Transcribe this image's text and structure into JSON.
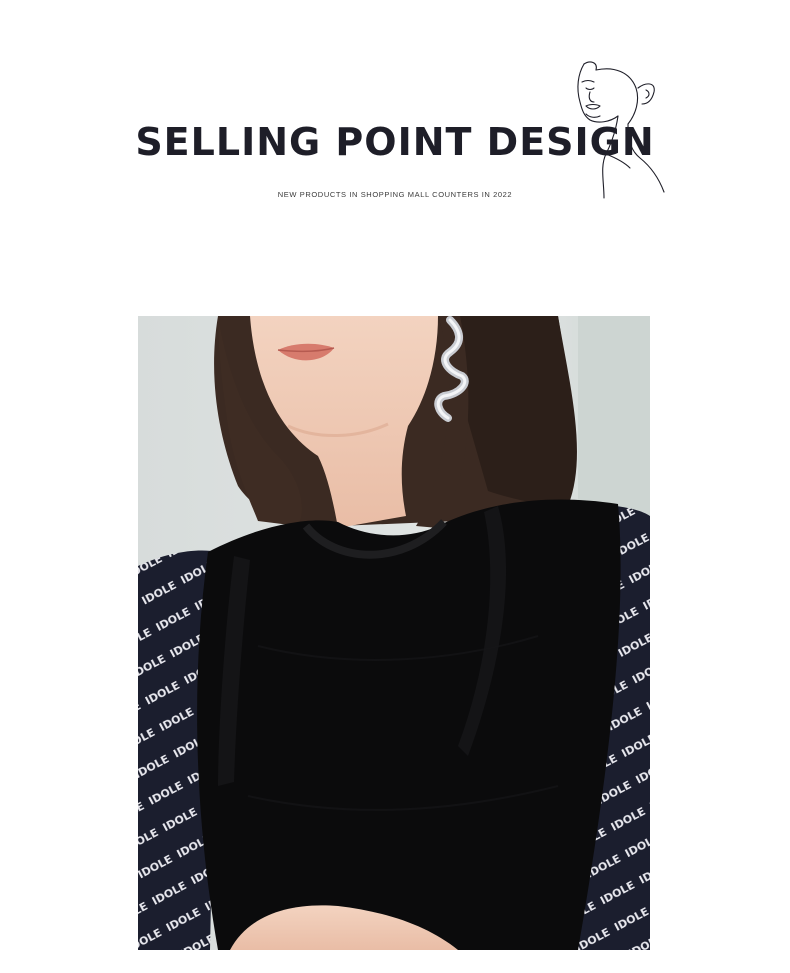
{
  "header": {
    "title": "SELLING POINT DESIGN",
    "subtitle": "NEW PRODUCTS IN SHOPPING MALL COUNTERS IN 2022"
  },
  "photo": {
    "print_text": "IDOLE"
  },
  "colors": {
    "title": "#1e1e28",
    "knit_top": "#0b0b0c",
    "blouse": "#1a1d2c",
    "background": "#dfe3e2",
    "skin": "#f1cdb7",
    "hair": "#3b2a22"
  }
}
